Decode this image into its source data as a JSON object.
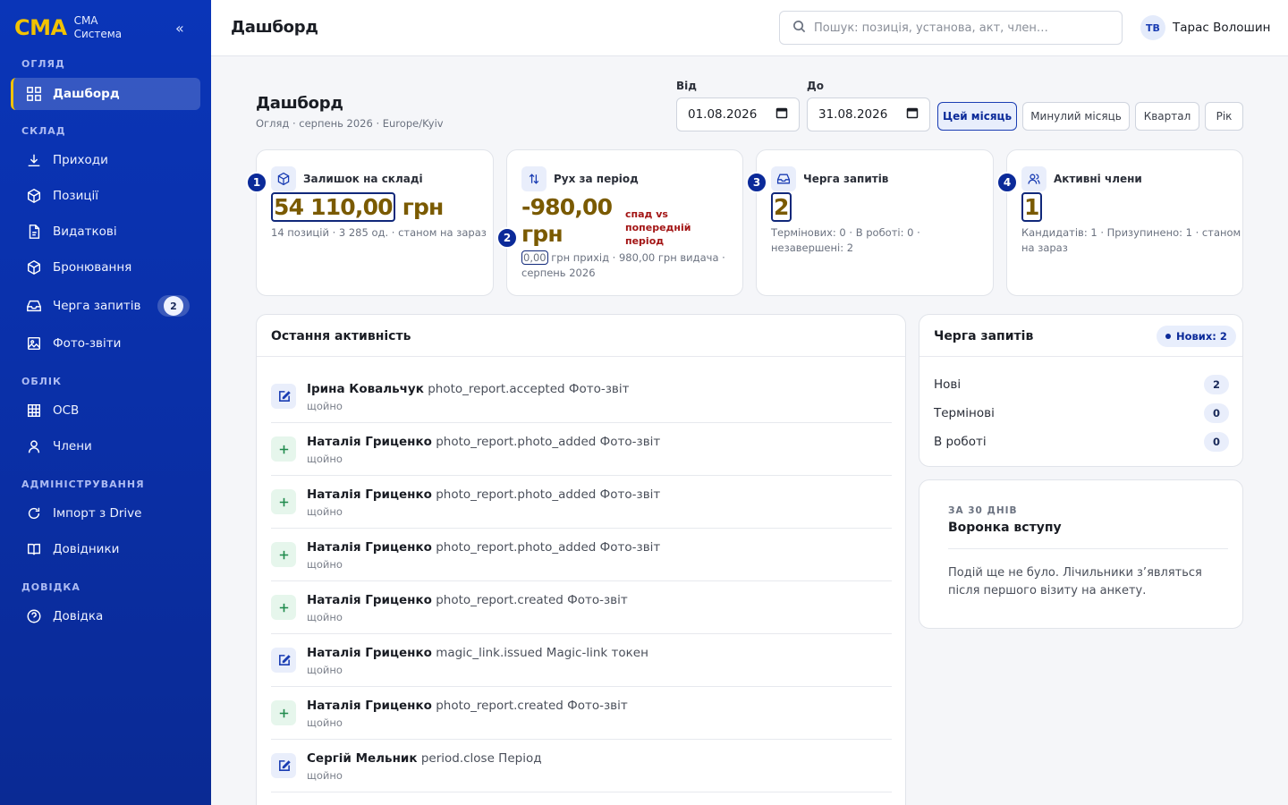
{
  "brand": {
    "logo": "CMA",
    "line1": "СМА",
    "line2": "Система",
    "collapse": "«"
  },
  "sidebar": {
    "sections": [
      "ОГЛЯД",
      "СКЛАД",
      "ОБЛІК",
      "АДМІНІСТРУВАННЯ",
      "ДОВІДКА"
    ],
    "items": [
      {
        "label": "Дашборд",
        "icon": "grid-icon",
        "active": true
      },
      {
        "label": "Приходи",
        "icon": "download-icon"
      },
      {
        "label": "Позиції",
        "icon": "box-icon"
      },
      {
        "label": "Видаткові",
        "icon": "document-icon"
      },
      {
        "label": "Бронювання",
        "icon": "box-icon"
      },
      {
        "label": "Черга запитів",
        "icon": "inbox-icon",
        "badge": "2"
      },
      {
        "label": "Фото-звіти",
        "icon": "image-icon"
      },
      {
        "label": "ОСВ",
        "icon": "table-icon"
      },
      {
        "label": "Члени",
        "icon": "user-icon"
      },
      {
        "label": "Імпорт з Drive",
        "icon": "refresh-icon"
      },
      {
        "label": "Довідники",
        "icon": "book-icon"
      },
      {
        "label": "Довідка",
        "icon": "help-icon"
      }
    ]
  },
  "topbar": {
    "title": "Дашборд",
    "search_placeholder": "Пошук: позиція, установа, акт, член…",
    "user_initials": "ТВ",
    "user_name": "Тарас Волошин"
  },
  "page": {
    "title": "Дашборд",
    "subtitle": "Огляд · серпень 2026 · Europe/Kyiv",
    "from_label": "Від",
    "from_value": "01.08.2026",
    "to_label": "До",
    "to_value": "31.08.2026",
    "periods": [
      "Цей місяць",
      "Минулий місяць",
      "Квартал",
      "Рік"
    ],
    "active_period": "Цей місяць"
  },
  "kpis": [
    {
      "marker": "1",
      "label": "Залишок на складі",
      "value": "54 110,00",
      "unit": "грн",
      "meta": "14 позицій · 3 285 од. · станом на зараз"
    },
    {
      "marker": "2",
      "label": "Рух за період",
      "value": "-980,00",
      "unit": "грн",
      "trend": "спад vs попередній період",
      "meta_highlight": "0,00",
      "meta_rest": " грн прихід · 980,00 грн видача ·",
      "meta_line2": "серпень 2026"
    },
    {
      "marker": "3",
      "label": "Черга запитів",
      "value": "2",
      "meta_line1": "Термінових: 0 · В роботі: 0 ·",
      "meta_line2": "незавершені: 2"
    },
    {
      "marker": "4",
      "label": "Активні члени",
      "value": "1",
      "meta_line1": "Кандидатів: 1 · Призупинено: 1 · станом",
      "meta_line2": "на зараз"
    }
  ],
  "activity": {
    "title": "Остання активність",
    "rows": [
      {
        "type": "edit",
        "actor": "Ірина Ковальчук",
        "action": "photo_report.accepted Фото-звіт",
        "time": "щойно"
      },
      {
        "type": "add",
        "actor": "Наталія Гриценко",
        "action": "photo_report.photo_added Фото-звіт",
        "time": "щойно"
      },
      {
        "type": "add",
        "actor": "Наталія Гриценко",
        "action": "photo_report.photo_added Фото-звіт",
        "time": "щойно"
      },
      {
        "type": "add",
        "actor": "Наталія Гриценко",
        "action": "photo_report.photo_added Фото-звіт",
        "time": "щойно"
      },
      {
        "type": "add",
        "actor": "Наталія Гриценко",
        "action": "photo_report.created Фото-звіт",
        "time": "щойно"
      },
      {
        "type": "edit",
        "actor": "Наталія Гриценко",
        "action": "magic_link.issued Magic-link токен",
        "time": "щойно"
      },
      {
        "type": "add",
        "actor": "Наталія Гриценко",
        "action": "photo_report.created Фото-звіт",
        "time": "щойно"
      },
      {
        "type": "edit",
        "actor": "Сергій Мельник",
        "action": "period.close Період",
        "time": "щойно"
      }
    ]
  },
  "queue": {
    "title": "Черга запитів",
    "badge": "Нових: 2",
    "rows": [
      {
        "label": "Нові",
        "count": "2"
      },
      {
        "label": "Термінові",
        "count": "0"
      },
      {
        "label": "В роботі",
        "count": "0"
      }
    ]
  },
  "funnel": {
    "eyebrow": "ЗА 30 ДНІВ",
    "title": "Воронка вступу",
    "text": "Подій ще не було. Лічильники з’являться після першого візиту на анкету."
  },
  "colors": {
    "sidebar": "#0a35b8",
    "accent": "#f2c200",
    "primary": "#1a3db3",
    "kpi_value": "#7a5a00",
    "negative": "#a31515"
  }
}
